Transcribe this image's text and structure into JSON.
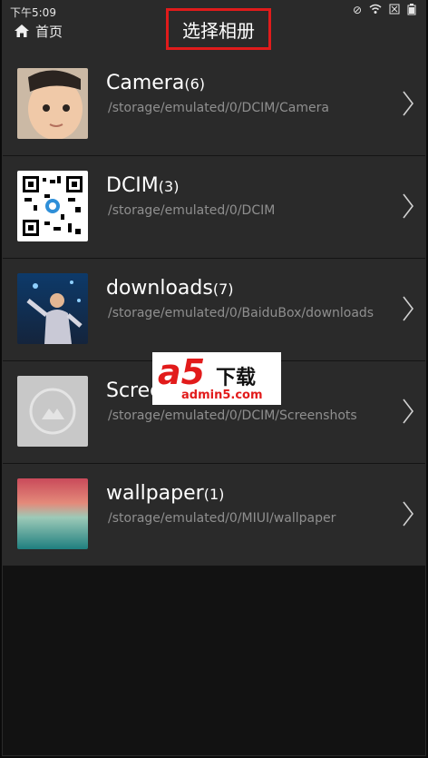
{
  "status": {
    "time": "下午5:09",
    "icons": [
      "alarm-off-icon",
      "wifi-icon",
      "sim-icon",
      "battery-icon"
    ]
  },
  "header": {
    "home_label": "首页",
    "title": "选择相册"
  },
  "albums": [
    {
      "name": "Camera",
      "count": "(6)",
      "path": "/storage/emulated/0/DCIM/Camera",
      "thumb": "baby-photo"
    },
    {
      "name": "DCIM",
      "count": "(3)",
      "path": "/storage/emulated/0/DCIM",
      "thumb": "qr-code"
    },
    {
      "name": "downloads",
      "count": "(7)",
      "path": "/storage/emulated/0/BaiduBox/downloads",
      "thumb": "concert-photo"
    },
    {
      "name": "Screenshots",
      "count": "",
      "path": "/storage/emulated/0/DCIM/Screenshots",
      "thumb": "placeholder-image"
    },
    {
      "name": "wallpaper",
      "count": "(1)",
      "path": "/storage/emulated/0/MIUI/wallpaper",
      "thumb": "sunset-sea"
    }
  ],
  "watermark": {
    "logo": "a5",
    "cn": "下载",
    "url": "admin5.com"
  },
  "colors": {
    "bar": "#2a2a2a",
    "highlight": "#e01b1b",
    "path_text": "#8f8f8f"
  }
}
